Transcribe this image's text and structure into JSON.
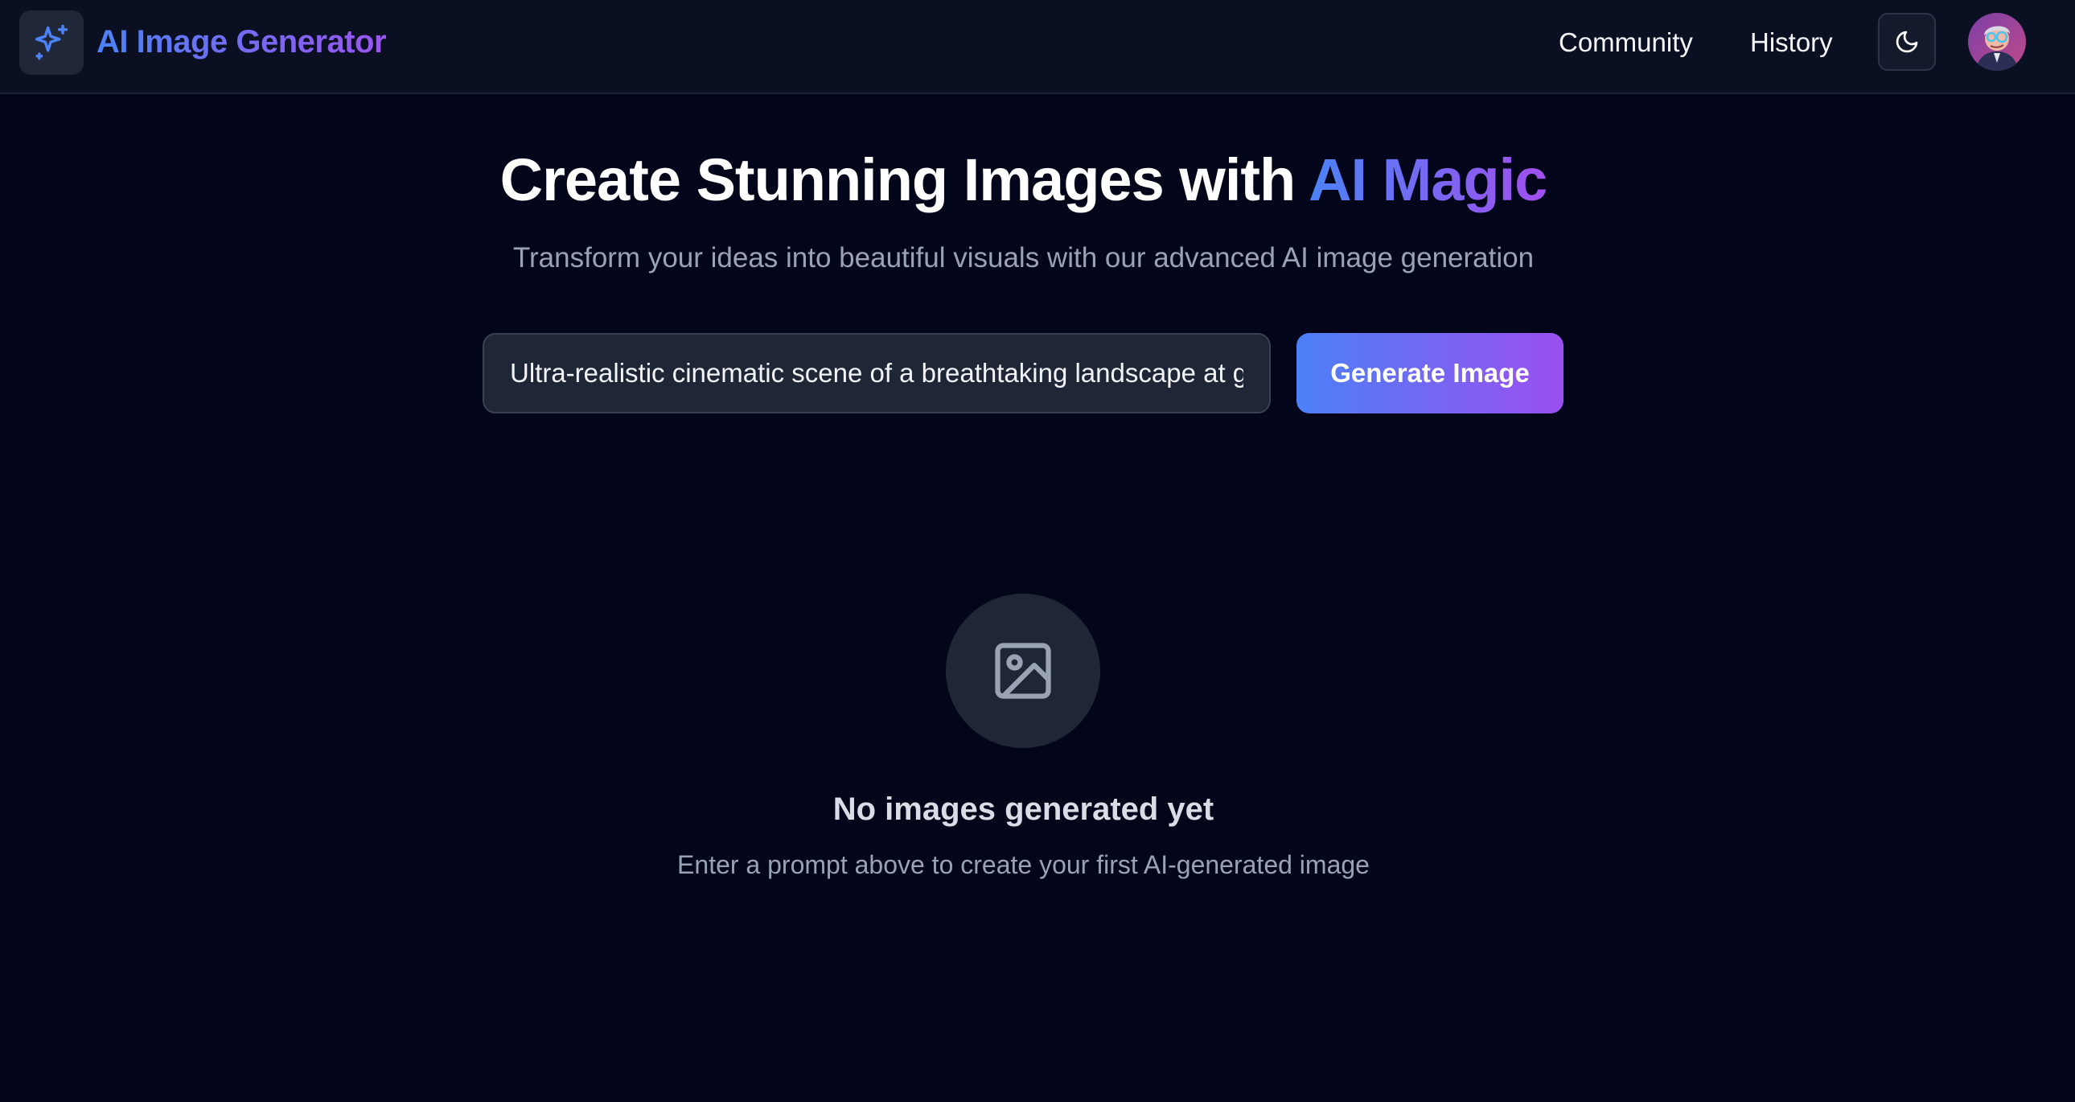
{
  "header": {
    "brand": "AI Image Generator",
    "nav": {
      "community": "Community",
      "history": "History"
    },
    "theme_toggle_icon": "moon-icon",
    "avatar_icon": "user-avatar",
    "logo_icon": "sparkles-icon"
  },
  "hero": {
    "title_main": "Create Stunning Images with ",
    "title_accent": "AI Magic",
    "subtitle": "Transform your ideas into beautiful visuals with our advanced AI image generation"
  },
  "prompt": {
    "value": "Ultra-realistic cinematic scene of a breathtaking landscape at g",
    "button_label": "Generate Image"
  },
  "empty_state": {
    "icon": "image-icon",
    "title": "No images generated yet",
    "subtitle": "Enter a prompt above to create your first AI-generated image"
  },
  "colors": {
    "background": "#03061a",
    "header_bg": "#0a0f21",
    "accent_start": "#4b82f6",
    "accent_end": "#9b55ef"
  }
}
